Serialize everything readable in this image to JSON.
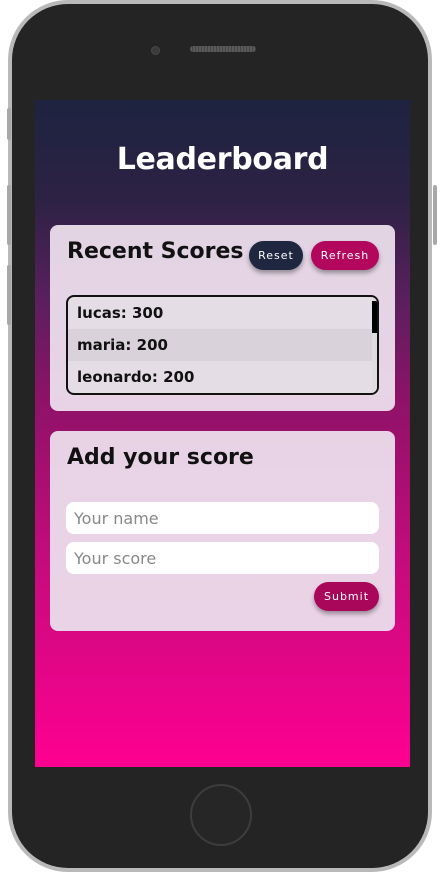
{
  "app": {
    "title": "Leaderboard"
  },
  "recent_scores": {
    "title": "Recent Scores",
    "reset_label": "Reset",
    "refresh_label": "Refresh",
    "items": [
      {
        "text": "lucas: 300"
      },
      {
        "text": "maria: 200"
      },
      {
        "text": "leonardo: 200"
      }
    ]
  },
  "add_score": {
    "title": "Add your score",
    "name_placeholder": "Your name",
    "score_placeholder": "Your score",
    "submit_label": "Submit"
  },
  "colors": {
    "reset_button": "#1f2640",
    "refresh_button": "#b3075e",
    "submit_button": "#a8075a",
    "gradient_top": "#1d2340",
    "gradient_bottom": "#ff0091"
  },
  "icons": [
    "front-camera-icon",
    "speaker-grille-icon",
    "home-button-icon"
  ]
}
